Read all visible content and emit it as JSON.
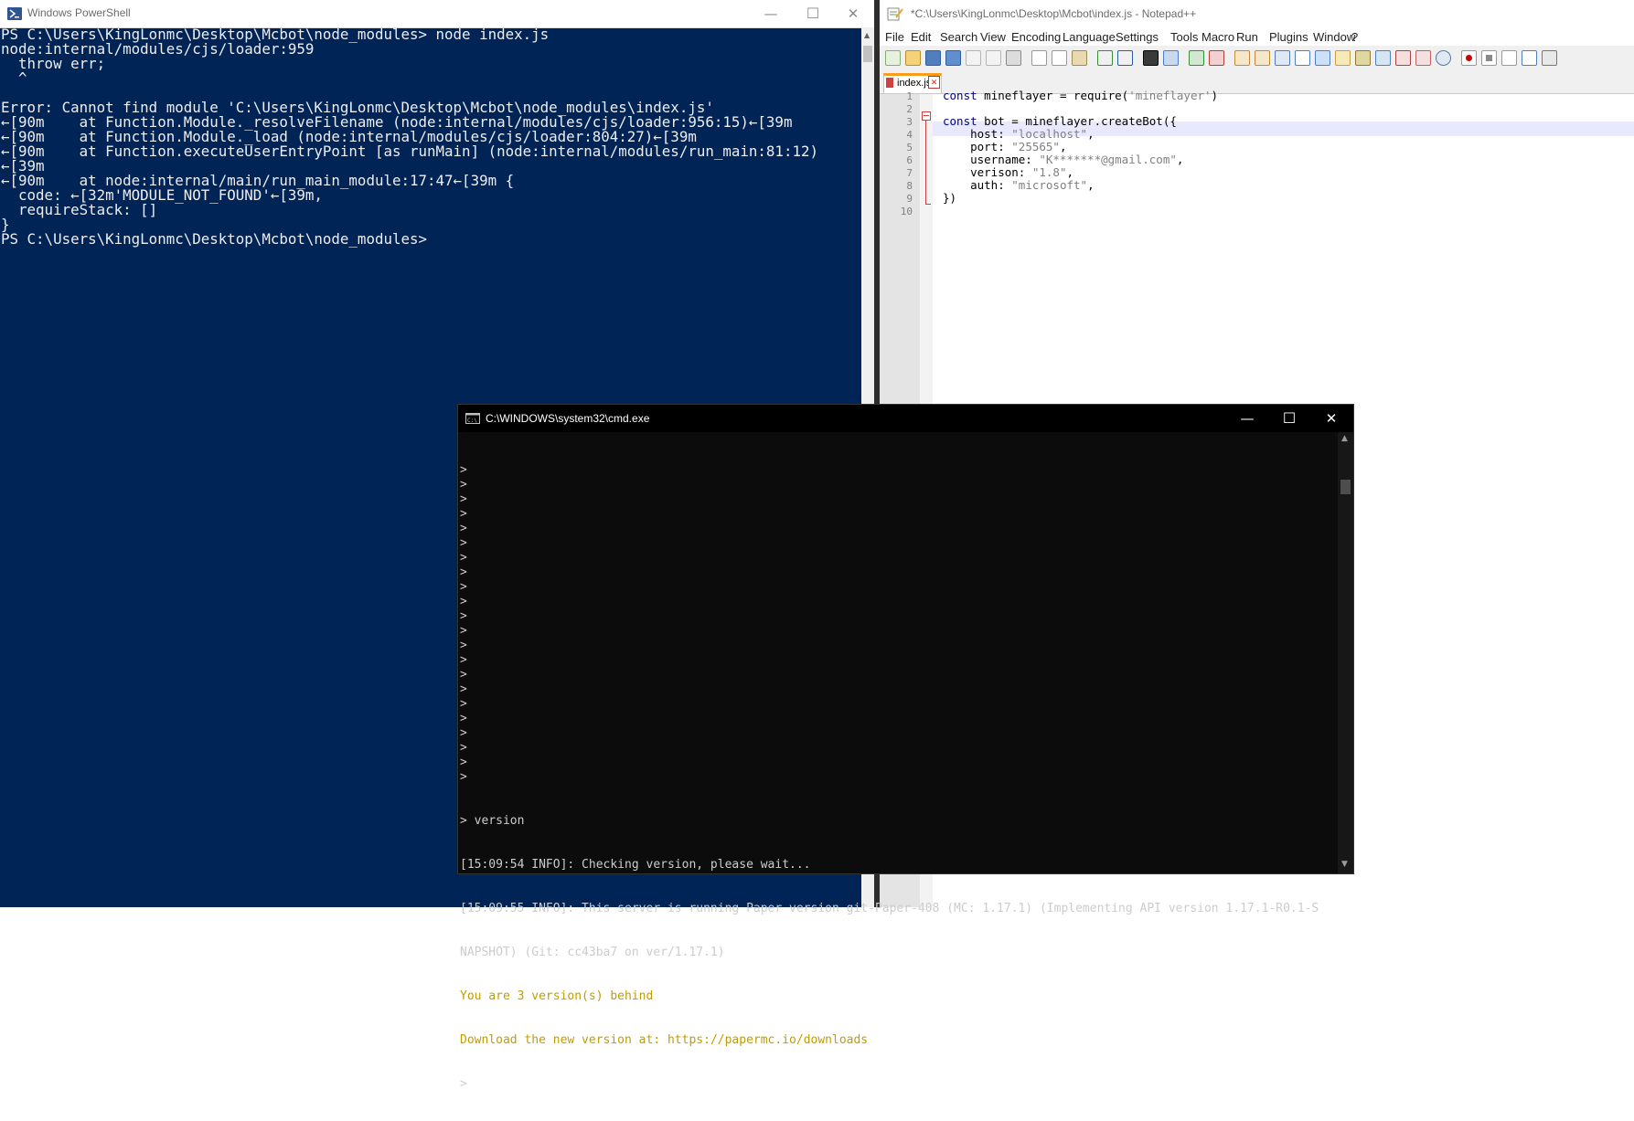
{
  "powershell": {
    "title": "Windows PowerShell",
    "lines": [
      "PS C:\\Users\\KingLonmc\\Desktop\\Mcbot\\node_modules> node index.js",
      "node:internal/modules/cjs/loader:959",
      "  throw err;",
      "  ^",
      "",
      "Error: Cannot find module 'C:\\Users\\KingLonmc\\Desktop\\Mcbot\\node_modules\\index.js'",
      "←[90m    at Function.Module._resolveFilename (node:internal/modules/cjs/loader:956:15)←[39m",
      "←[90m    at Function.Module._load (node:internal/modules/cjs/loader:804:27)←[39m",
      "←[90m    at Function.executeUserEntryPoint [as runMain] (node:internal/modules/run_main:81:12)",
      "←[39m",
      "←[90m    at node:internal/main/run_main_module:17:47←[39m {",
      "  code: ←[32m'MODULE_NOT_FOUND'←[39m,",
      "  requireStack: []",
      "}",
      "PS C:\\Users\\KingLonmc\\Desktop\\Mcbot\\node_modules>"
    ]
  },
  "notepad": {
    "title": "*C:\\Users\\KingLonmc\\Desktop\\Mcbot\\index.js - Notepad++",
    "menu": [
      "File",
      "Edit",
      "Search",
      "View",
      "Encoding",
      "Language",
      "Settings",
      "Tools",
      "Macro",
      "Run",
      "Plugins",
      "Window",
      "?"
    ],
    "tab_label": "index.js",
    "line_numbers": [
      "1",
      "2",
      "3",
      "4",
      "5",
      "6",
      "7",
      "8",
      "9",
      "10"
    ],
    "code": {
      "l1_kw": "const",
      "l1_rest": " mineflayer = require(",
      "l1_str": "'mineflayer'",
      "l1_end": ")",
      "l3_kw": "const",
      "l3_rest": " bot = mineflayer.createBot({",
      "l4_key": "    host: ",
      "l4_val": "\"localhost\"",
      "l5_key": "    port: ",
      "l5_val": "\"25565\"",
      "l6_key": "    username: ",
      "l6_val": "\"K*******@gmail.com\"",
      "l7_key": "    verison: ",
      "l7_val": "\"1.8\"",
      "l8_key": "    auth: ",
      "l8_val": "\"microsoft\"",
      "l9": "})",
      "comma": ","
    }
  },
  "cmd": {
    "title": "C:\\WINDOWS\\system32\\cmd.exe",
    "prompt_lines": [
      ">",
      ">",
      ">",
      ">",
      ">",
      ">",
      ">",
      ">",
      ">",
      ">",
      ">",
      ">",
      ">",
      ">",
      ">",
      ">",
      ">",
      ">",
      ">",
      ">",
      ">",
      ">"
    ],
    "version_cmd": "> version",
    "line1": "[15:09:54 INFO]: Checking version, please wait...",
    "line2": "[15:09:55 INFO]: This server is running Paper version git-Paper-408 (MC: 1.17.1) (Implementing API version 1.17.1-R0.1-S",
    "line3": "NAPSHOT) (Git: cc43ba7 on ver/1.17.1)",
    "line4": "You are 3 version(s) behind",
    "line5_prefix": "Download the new version at: ",
    "line5_link": "https://papermc.io/downloads",
    "last_prompt": ">"
  },
  "colors": {
    "powershell_bg": "#012456",
    "cmd_bg": "#0c0c0c",
    "cmd_yellow": "#c19c00",
    "notepad_tab_accent": "#fa9d1c"
  },
  "icons": {
    "window_controls": [
      "minimize-icon",
      "maximize-icon",
      "close-icon"
    ],
    "minimize_glyph": "—",
    "maximize_glyph": "☐",
    "close_glyph": "✕",
    "tab_close_glyph": "✕"
  }
}
